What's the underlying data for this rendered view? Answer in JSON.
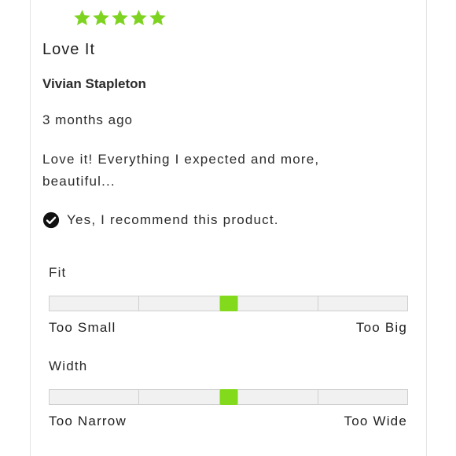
{
  "review": {
    "rating": 5,
    "rating_max": 5,
    "star_color": "#7ed321",
    "title": "Love It",
    "author": "Vivian Stapleton",
    "date": "3 months ago",
    "body": "Love it! Everything I expected and more, beautiful...",
    "recommend_text": "Yes, I recommend this product.",
    "recommend_icon": "check-circle-icon"
  },
  "fit": {
    "label": "Fit",
    "min_label": "Too Small",
    "max_label": "Too Big",
    "level": 0.5,
    "marker_color": "#83d91b"
  },
  "width": {
    "label": "Width",
    "min_label": "Too Narrow",
    "max_label": "Too Wide",
    "level": 0.5,
    "marker_color": "#83d91b"
  }
}
